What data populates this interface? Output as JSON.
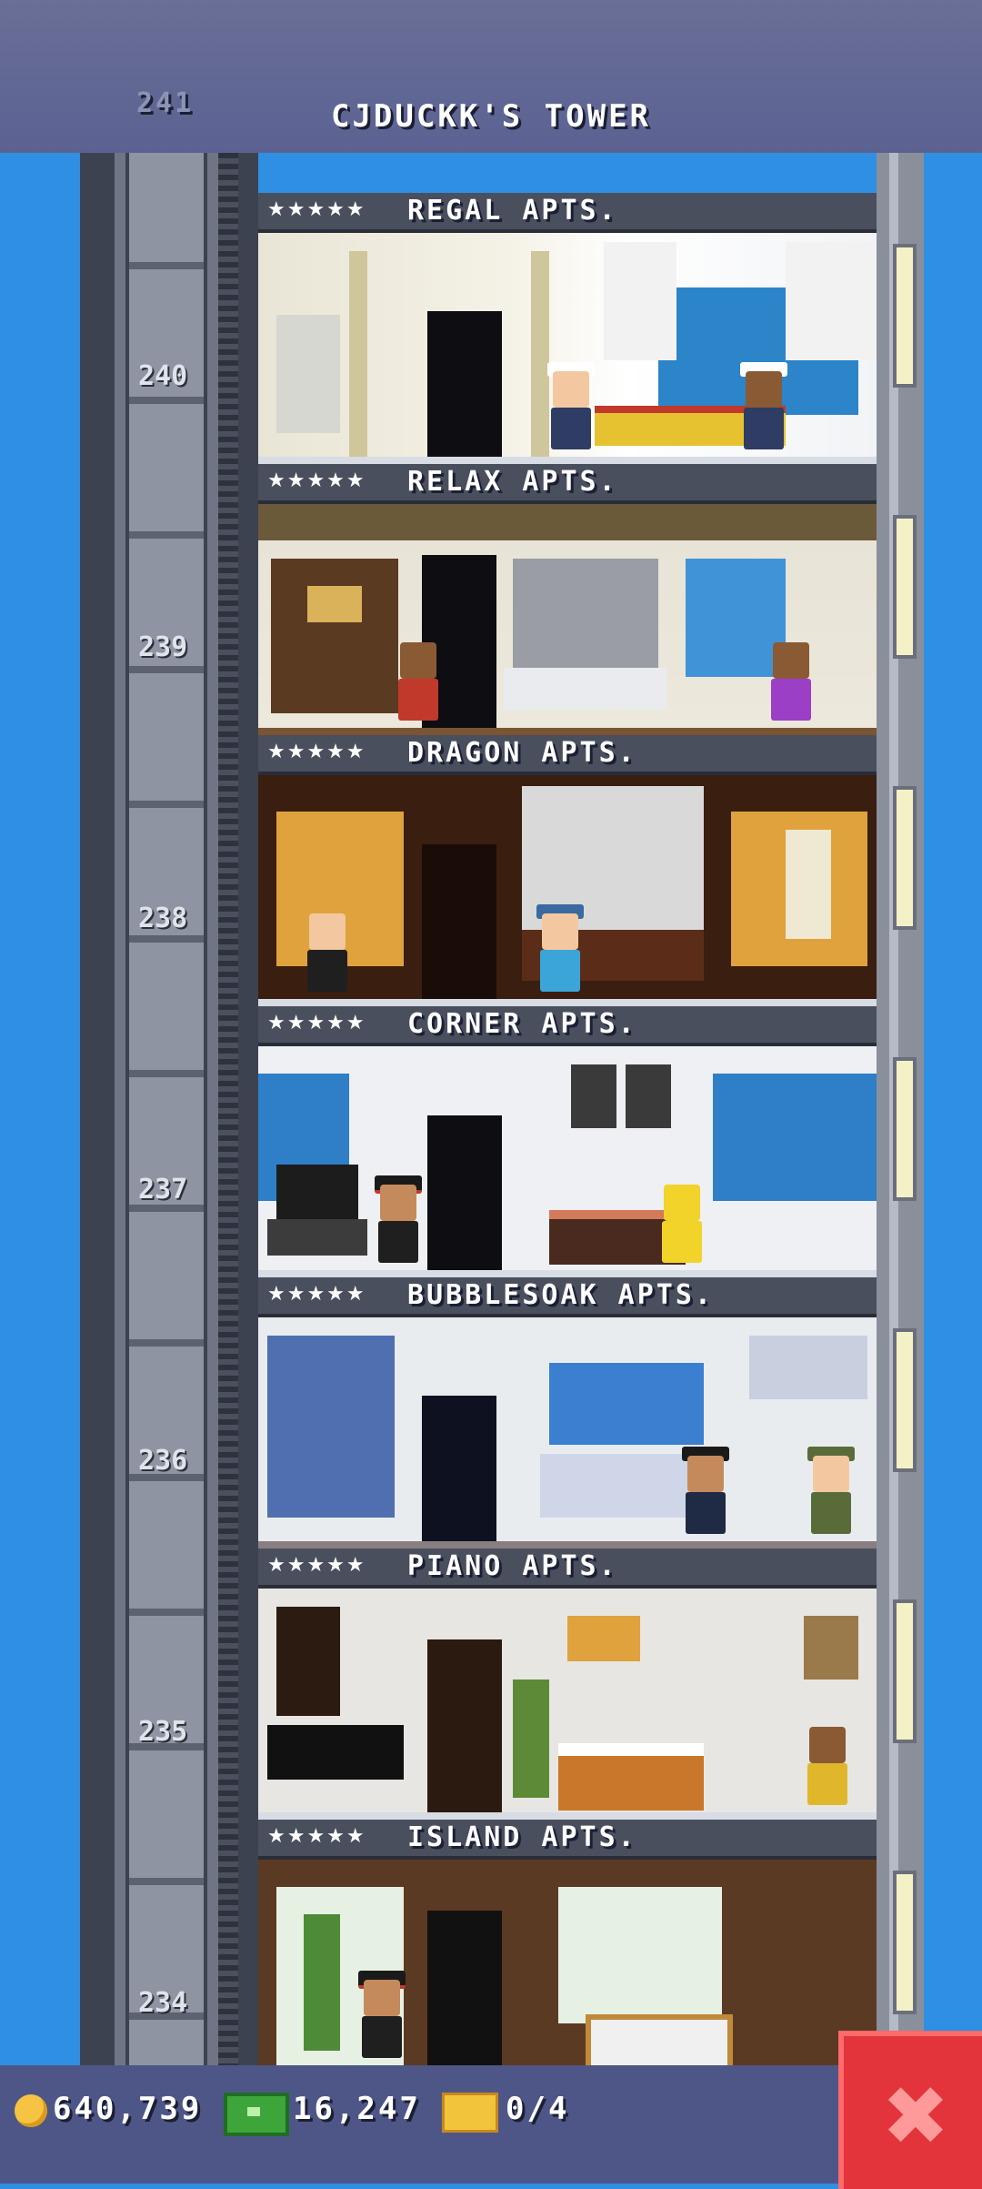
{
  "header": {
    "title": "CJDUCKK'S TOWER",
    "top_floor_number": "241"
  },
  "floors": [
    {
      "number": "240",
      "name": "REGAL APTS.",
      "stars": "★★★★★"
    },
    {
      "number": "239",
      "name": "RELAX APTS.",
      "stars": "★★★★★"
    },
    {
      "number": "238",
      "name": "DRAGON APTS.",
      "stars": "★★★★★"
    },
    {
      "number": "237",
      "name": "CORNER APTS.",
      "stars": "★★★★★"
    },
    {
      "number": "236",
      "name": "BUBBLESOAK APTS.",
      "stars": "★★★★★"
    },
    {
      "number": "235",
      "name": "PIANO APTS.",
      "stars": "★★★★★"
    },
    {
      "number": "234",
      "name": "ISLAND APTS.",
      "stars": "★★★★★"
    }
  ],
  "resources": {
    "coins": "640,739",
    "bux": "16,247",
    "tickets": "0/4"
  },
  "icons": {
    "coin": "coin-icon",
    "bux": "cash-icon",
    "tickets": "ticket-icon",
    "close": "close-icon"
  },
  "colors": {
    "sky": "#2f8fe3",
    "header_bar": "#5b6292",
    "bottom_bar": "#4e5688",
    "close_button": "#e2343a"
  }
}
